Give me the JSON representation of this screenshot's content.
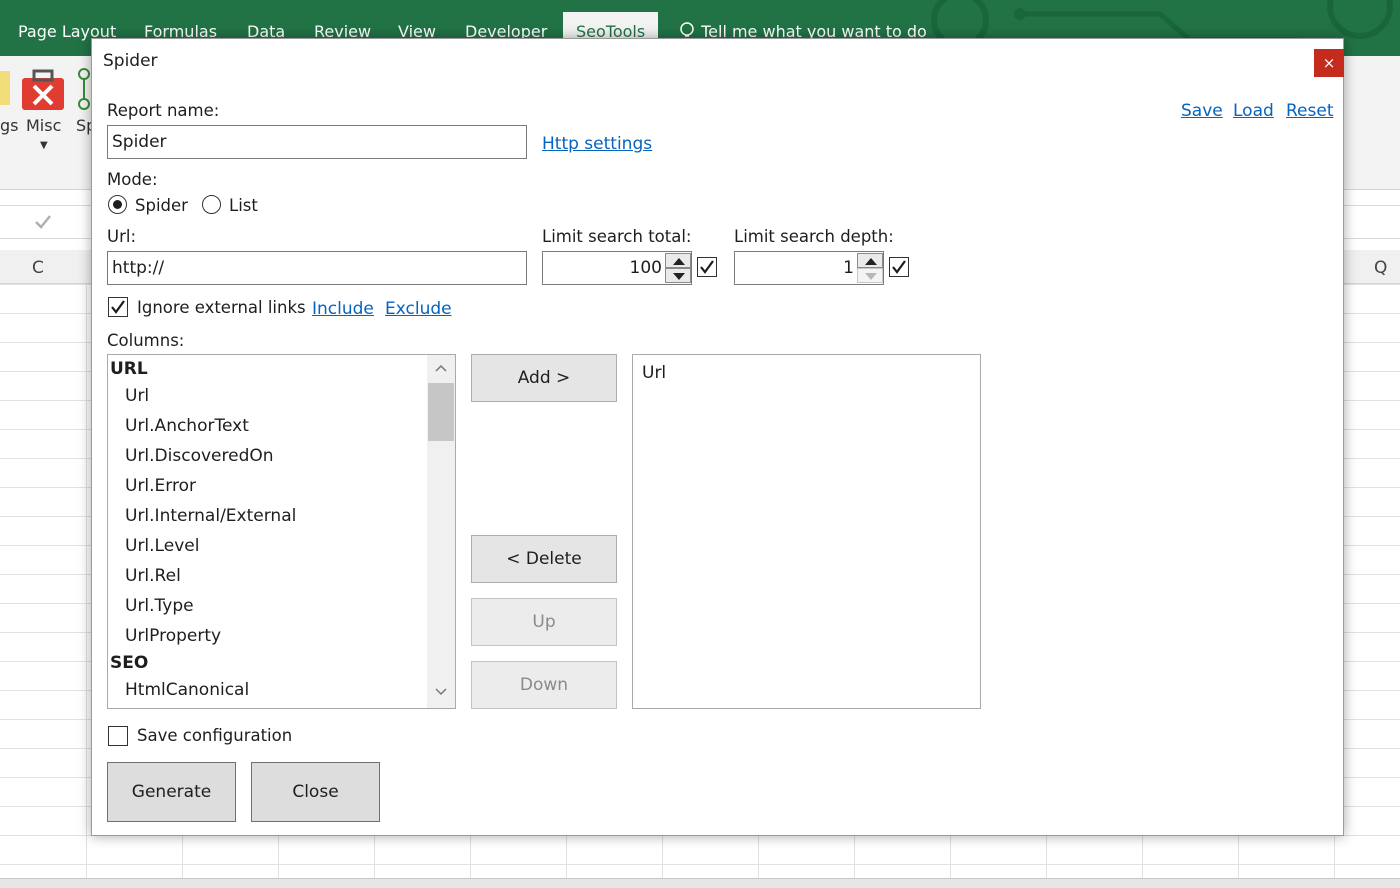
{
  "excel": {
    "ribbon_tabs": [
      "Page Layout",
      "Formulas",
      "Data",
      "Review",
      "View",
      "Developer",
      "SeoTools"
    ],
    "active_tab": "SeoTools",
    "tell_me": "Tell me what you want to do",
    "ribbon_groups": {
      "left_partial": "gs",
      "misc": "Misc",
      "right_partial": "Sp"
    },
    "column_letters": {
      "left": "C",
      "right": "Q"
    },
    "accent_color": "#217346"
  },
  "dialog": {
    "title": "Spider",
    "close_glyph": "×",
    "report_name_label": "Report name:",
    "report_name_value": "Spider",
    "http_settings_link": "Http settings",
    "top_links": {
      "save": "Save",
      "load": "Load",
      "reset": "Reset"
    },
    "mode_label": "Mode:",
    "mode_options": [
      {
        "label": "Spider",
        "selected": true
      },
      {
        "label": "List",
        "selected": false
      }
    ],
    "url_label": "Url:",
    "url_value": "http://",
    "limit_total": {
      "label": "Limit search total:",
      "value": "100",
      "checked": true
    },
    "limit_depth": {
      "label": "Limit search depth:",
      "value": "1",
      "checked": true
    },
    "ignore_external": {
      "label": "Ignore external links",
      "checked": true
    },
    "include_link": "Include",
    "exclude_link": "Exclude",
    "columns_label": "Columns:",
    "available_columns": [
      {
        "text": "URL",
        "group": true
      },
      {
        "text": "Url",
        "group": false
      },
      {
        "text": "Url.AnchorText",
        "group": false
      },
      {
        "text": "Url.DiscoveredOn",
        "group": false
      },
      {
        "text": "Url.Error",
        "group": false
      },
      {
        "text": "Url.Internal/External",
        "group": false
      },
      {
        "text": "Url.Level",
        "group": false
      },
      {
        "text": "Url.Rel",
        "group": false
      },
      {
        "text": "Url.Type",
        "group": false
      },
      {
        "text": "UrlProperty",
        "group": false
      },
      {
        "text": "SEO",
        "group": true
      },
      {
        "text": "HtmlCanonical",
        "group": false
      }
    ],
    "selected_columns": [
      "Url"
    ],
    "buttons": {
      "add": "Add >",
      "delete": "< Delete",
      "up": "Up",
      "down": "Down",
      "generate": "Generate",
      "close": "Close"
    },
    "save_configuration": {
      "label": "Save configuration",
      "checked": false
    },
    "link_color": "#0563c1",
    "close_button_color": "#c42b1c"
  }
}
